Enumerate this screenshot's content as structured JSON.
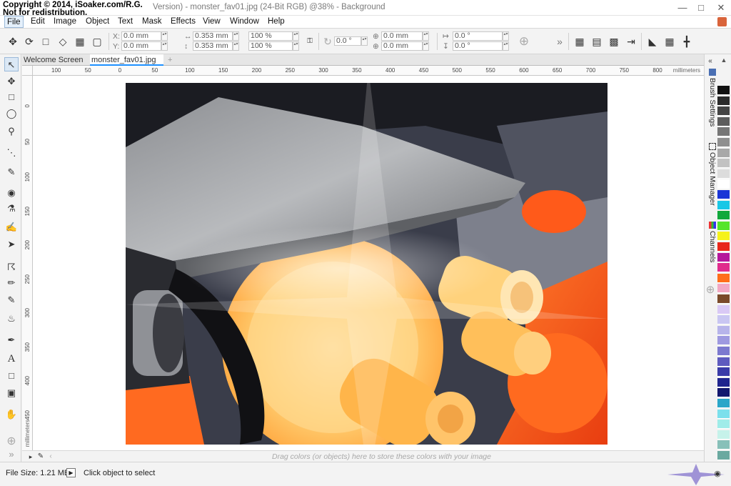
{
  "window": {
    "copyright_line1": "Copyright © 2014, iSoaker.com/R.G.",
    "copyright_line2": "Not for redistribution.",
    "title": "Version) - monster_fav01.jpg (24-Bit RGB) @38% - Background"
  },
  "menu": {
    "items": [
      "File",
      "Edit",
      "Image",
      "Object",
      "Text",
      "Mask",
      "Effects",
      "View",
      "Window",
      "Help"
    ]
  },
  "propbar": {
    "x_label": "X:",
    "x_value": "0.0 mm",
    "y_label": "Y:",
    "y_value": "0.0 mm",
    "w_value": "0.353 mm",
    "h_value": "0.353 mm",
    "scale_w": "100 %",
    "scale_h": "100 %",
    "rotate": "0.0 °",
    "cx": "0.0 mm",
    "cy": "0.0 mm",
    "skew_h": "0.0 °",
    "skew_v": "0.0 °"
  },
  "tabs": {
    "welcome": "Welcome Screen",
    "doc": "monster_fav01.jpg",
    "add": "+"
  },
  "ruler": {
    "top_labels": [
      "100",
      "50",
      "0",
      "50",
      "100",
      "150",
      "200",
      "250",
      "300",
      "350",
      "400",
      "450",
      "500",
      "550",
      "600",
      "650",
      "700",
      "750",
      "800"
    ],
    "unit": "millimeters",
    "left_labels": [
      "0",
      "50",
      "100",
      "150",
      "200",
      "250",
      "300",
      "350",
      "400",
      "450"
    ],
    "left_unit": "millimeters"
  },
  "dockers": {
    "brush": "Brush Settings",
    "objects": "Object Manager",
    "channels": "Channels"
  },
  "colortray": {
    "hint": "Drag colors (or objects) here to store these colors with your image"
  },
  "status": {
    "file_size": "File Size: 1.21 MB",
    "hint": "Click object to select"
  },
  "palette": [
    "#111111",
    "#2b2b2b",
    "#444444",
    "#5c5c5c",
    "#767676",
    "#8f8f8f",
    "#a8a8a8",
    "#c2c2c2",
    "#dcdcdc",
    "#ffffff",
    "#1a35d6",
    "#19c7e6",
    "#11a83b",
    "#55e52a",
    "#f5f21b",
    "#e8261b",
    "#b5179b",
    "#e02c8c",
    "#ff6e1a",
    "#f3a8c4",
    "#7a4a2a",
    "#d9c9f5",
    "#c9c6f2",
    "#b7b4ea",
    "#9e99e0",
    "#7c79cf",
    "#5e5bbf",
    "#3a3ba8",
    "#20258e",
    "#12176e",
    "#2aa6c9",
    "#7be0ec",
    "#9fece9",
    "#c6f2ea",
    "#87c0b9",
    "#6aa9a0"
  ]
}
